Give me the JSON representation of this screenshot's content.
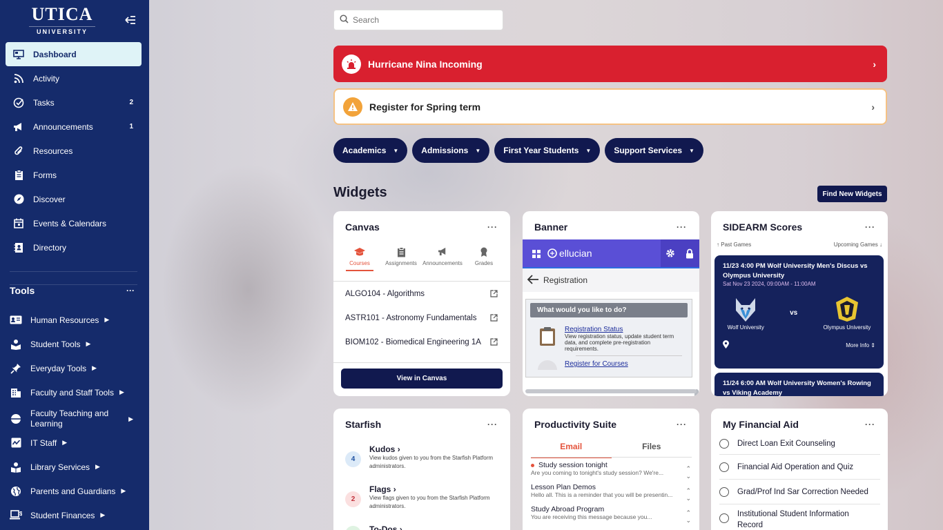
{
  "brand": {
    "main": "UTICA",
    "sub": "UNIVERSITY"
  },
  "nav": [
    {
      "label": "Dashboard",
      "icon": "monitor-icon",
      "active": true
    },
    {
      "label": "Activity",
      "icon": "rss-icon"
    },
    {
      "label": "Tasks",
      "icon": "check-circle-icon",
      "badge": "2"
    },
    {
      "label": "Announcements",
      "icon": "megaphone-icon",
      "badge": "1"
    },
    {
      "label": "Resources",
      "icon": "paperclip-icon"
    },
    {
      "label": "Forms",
      "icon": "clipboard-icon"
    },
    {
      "label": "Discover",
      "icon": "compass-icon"
    },
    {
      "label": "Events & Calendars",
      "icon": "calendar-icon"
    },
    {
      "label": "Directory",
      "icon": "contact-book-icon"
    }
  ],
  "tools": {
    "title": "Tools",
    "menu": "···",
    "items": [
      {
        "label": "Human Resources",
        "icon": "id-card-icon"
      },
      {
        "label": "Student Tools",
        "icon": "student-icon"
      },
      {
        "label": "Everyday Tools",
        "icon": "pin-icon"
      },
      {
        "label": "Faculty and Staff Tools",
        "icon": "building-icon"
      },
      {
        "label": "Faculty Teaching and Learning",
        "icon": "globe-half-icon"
      },
      {
        "label": "IT Staff",
        "icon": "chart-icon"
      },
      {
        "label": "Library Services",
        "icon": "book-reader-icon"
      },
      {
        "label": "Parents and Guardians",
        "icon": "globe-icon"
      },
      {
        "label": "Student Finances",
        "icon": "laptop-dollar-icon"
      }
    ]
  },
  "search": {
    "placeholder": "Search"
  },
  "alerts": [
    {
      "label": "Hurricane Nina Incoming",
      "arrow": "›"
    },
    {
      "label": "Register for Spring term",
      "arrow": "›"
    }
  ],
  "pills": [
    "Academics",
    "Admissions",
    "First Year Students",
    "Support Services"
  ],
  "widgets_heading": "Widgets",
  "find_widgets": "Find New Widgets",
  "canvas": {
    "title": "Canvas",
    "menu": "···",
    "tabs": [
      "Courses",
      "Assignments",
      "Announcements",
      "Grades"
    ],
    "courses": [
      "ALGO104 - Algorithms",
      "ASTR101 - Astronomy Fundamentals",
      "BIOM102 - Biomedical Engineering 1A"
    ],
    "button": "View in Canvas"
  },
  "banner": {
    "title": "Banner",
    "menu": "···",
    "brand": "ellucian",
    "section": "Registration",
    "question": "What would you like to do?",
    "items": [
      {
        "link": "Registration Status",
        "desc": "View registration status, update student term data, and complete pre-registration requirements."
      },
      {
        "link": "Register for Courses",
        "desc": ""
      }
    ]
  },
  "sidearm": {
    "title": "SIDEARM Scores",
    "menu": "···",
    "past": "Past Games",
    "upcoming": "Upcoming Games",
    "games": [
      {
        "title": "11/23 4:00 PM Wolf University Men's Discus vs Olympus University",
        "date": "Sat Nov 23 2024, 09:00AM - 11:00AM",
        "home": "Wolf University",
        "vs": "vs",
        "away": "Olympus University",
        "more": "More Info"
      },
      {
        "title": "11/24 6:00 AM Wolf University Women's Rowing vs Viking Academy"
      }
    ]
  },
  "starfish": {
    "title": "Starfish",
    "menu": "···",
    "items": [
      {
        "count": "4",
        "title": "Kudos",
        "desc": "View kudos given to you from the Starfish Platform administrators."
      },
      {
        "count": "2",
        "title": "Flags",
        "desc": "View flags given to you from the Starfish Platform administrators."
      },
      {
        "count": "",
        "title": "To-Dos",
        "desc": ""
      }
    ]
  },
  "productivity": {
    "title": "Productivity Suite",
    "menu": "···",
    "tabs": [
      "Email",
      "Files"
    ],
    "mails": [
      {
        "subject": "Study session tonight",
        "preview": "Are you coming to tonight's study session? We're...",
        "unread": true
      },
      {
        "subject": "Lesson Plan Demos",
        "preview": "Hello all. This is a reminder that you will be presentin...",
        "unread": false
      },
      {
        "subject": "Study Abroad Program",
        "preview": "You are receiving this message because you...",
        "unread": false
      }
    ]
  },
  "financial_aid": {
    "title": "My Financial Aid",
    "menu": "···",
    "items": [
      "Direct Loan Exit Counseling",
      "Financial Aid Operation and Quiz",
      "Grad/Prof Ind Sar Correction Needed",
      "Institutional Student Information Record"
    ]
  },
  "colors": {
    "sidebar": "#152b6b",
    "alert_red": "#d9202f",
    "pill": "#11194f",
    "accent": "#e4533c"
  }
}
